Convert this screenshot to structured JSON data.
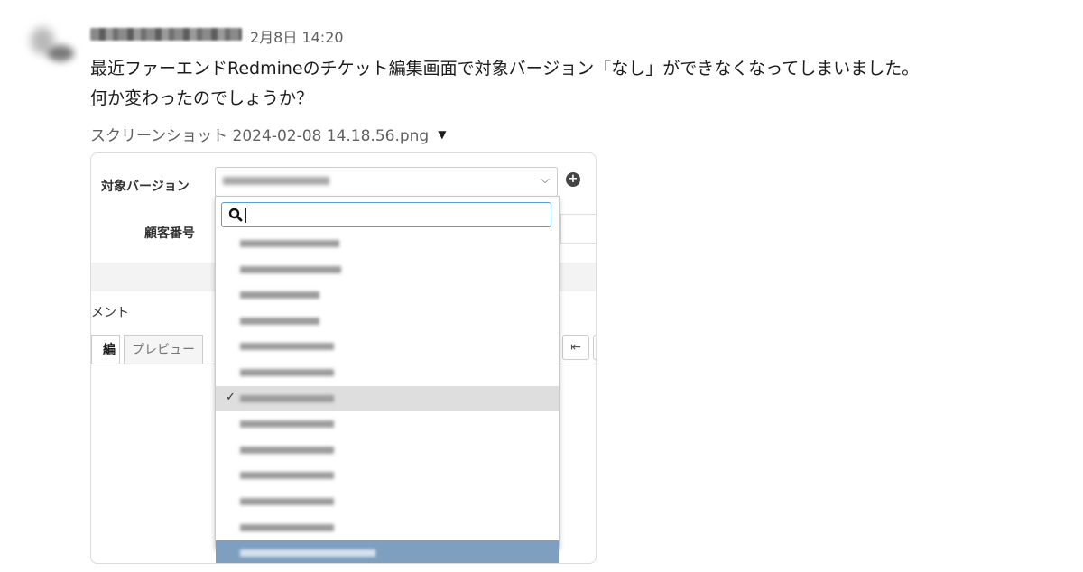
{
  "message": {
    "timestamp": "2月8日 14:20",
    "line1": "最近ファーエンドRedmineのチケット編集画面で対象バージョン「なし」ができなくなってしまいました。",
    "line2": "何か変わったのでしょうか？",
    "attachment_name": "スクリーンショット 2024-02-08 14.18.56.png",
    "attachment_caret": "▼"
  },
  "screenshot": {
    "version_label": "対象バージョン",
    "customer_label": "顧客番号",
    "comment_label": "メント",
    "tab_edit": "編集",
    "tab_preview": "プレビュー",
    "select_chevron": "⌵",
    "plus_icon": "+",
    "indent_icon": "⇤",
    "check_mark": "✓"
  },
  "dropdown": {
    "selected_index": 6,
    "highlighted_index": 12,
    "option_count": 13
  }
}
